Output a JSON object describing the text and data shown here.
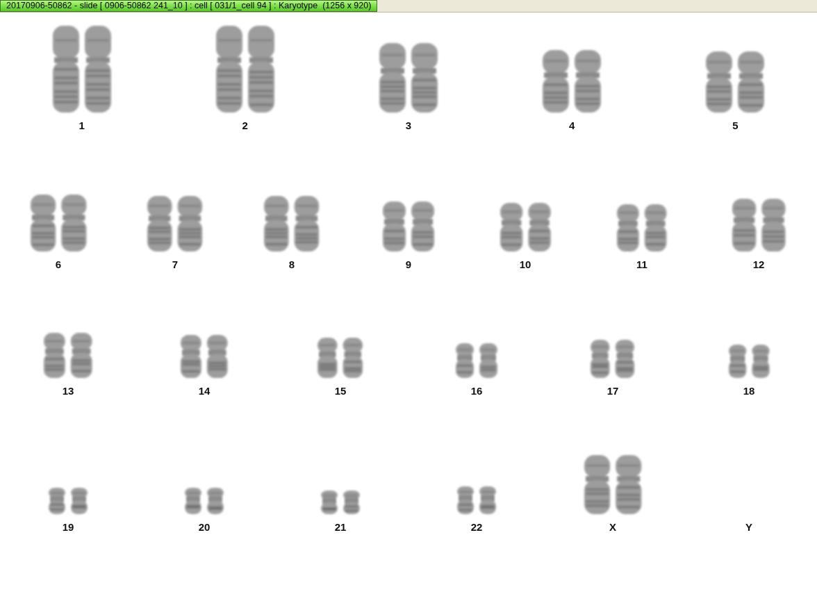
{
  "window": {
    "title": "20170906-50862 - slide [ 0906-50862 241_10 ] : cell [ 031/1_cell 94 ] : Karyotype  (1256 x 920)"
  },
  "karyotype": {
    "rows": [
      {
        "items": [
          {
            "label": "1",
            "kind": "pair"
          },
          {
            "label": "2",
            "kind": "pair"
          },
          {
            "label": "3",
            "kind": "pair"
          },
          {
            "label": "4",
            "kind": "pair"
          },
          {
            "label": "5",
            "kind": "pair"
          }
        ]
      },
      {
        "items": [
          {
            "label": "6",
            "kind": "pair"
          },
          {
            "label": "7",
            "kind": "pair"
          },
          {
            "label": "8",
            "kind": "pair"
          },
          {
            "label": "9",
            "kind": "pair"
          },
          {
            "label": "10",
            "kind": "pair"
          },
          {
            "label": "11",
            "kind": "pair"
          },
          {
            "label": "12",
            "kind": "pair"
          }
        ]
      },
      {
        "items": [
          {
            "label": "13",
            "kind": "pair"
          },
          {
            "label": "14",
            "kind": "pair"
          },
          {
            "label": "15",
            "kind": "pair"
          },
          {
            "label": "16",
            "kind": "pair"
          },
          {
            "label": "17",
            "kind": "pair"
          },
          {
            "label": "18",
            "kind": "pair"
          }
        ]
      },
      {
        "items": [
          {
            "label": "19",
            "kind": "pair"
          },
          {
            "label": "20",
            "kind": "pair"
          },
          {
            "label": "21",
            "kind": "pair"
          },
          {
            "label": "22",
            "kind": "pair"
          },
          {
            "label": "X",
            "kind": "pair"
          },
          {
            "label": "Y",
            "kind": "empty"
          }
        ]
      }
    ]
  }
}
